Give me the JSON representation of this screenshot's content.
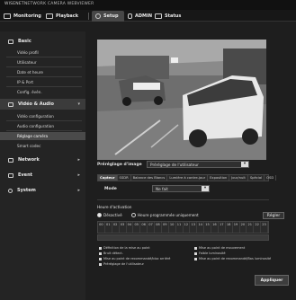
{
  "brand": {
    "prefix": "WISENET",
    "title": "NETWORK CAMERA WEBVIEWER"
  },
  "topnav": {
    "monitoring": "Monitoring",
    "playback": "Playback",
    "setup": "Setup",
    "admin": "ADMIN",
    "status": "Status"
  },
  "sidebar": {
    "basic": {
      "label": "Basic",
      "items": [
        "Vidéo profil",
        "Utilisateur",
        "Date et heure",
        "IP & Port",
        "Config. évén."
      ]
    },
    "video_audio": {
      "label": "Vidéo & Audio",
      "items": [
        "Vidéo configuration",
        "Audio configuration",
        "Réglage caméra",
        "Smart codec"
      ]
    },
    "network": {
      "label": "Network"
    },
    "event": {
      "label": "Event"
    },
    "system": {
      "label": "System"
    }
  },
  "preset": {
    "label": "Préréglage d'image",
    "value": "Préréglage de l'utilisateur"
  },
  "tabs": [
    "Capteur",
    "SSDR",
    "Balance des Blancs",
    "Lumière à contre-jour",
    "Exposition",
    "Jour/nuit",
    "Spécial",
    "OSD"
  ],
  "mode": {
    "label": "Mode",
    "value": "Ne fait"
  },
  "schedule": {
    "title": "Heure d'activation",
    "disabled": "Désactivé",
    "scheduled": "Heure programmée uniquement",
    "apply_btn": "Régler",
    "hours": [
      "00",
      "01",
      "02",
      "03",
      "04",
      "05",
      "06",
      "07",
      "08",
      "09",
      "10",
      "11",
      "12",
      "13",
      "14",
      "15",
      "16",
      "17",
      "18",
      "19",
      "20",
      "21",
      "22",
      "23"
    ],
    "legend": [
      "Définition de la mise au point",
      "Mise au point de mouvement",
      "Bruit détect.",
      "Faible luminosité",
      "Mise au point de recommandé/bloc arriéré",
      "Mise au point de recommandé/Bas luminosité",
      "Préréglage de l'utilisateur"
    ]
  },
  "apply": "Appliquer"
}
